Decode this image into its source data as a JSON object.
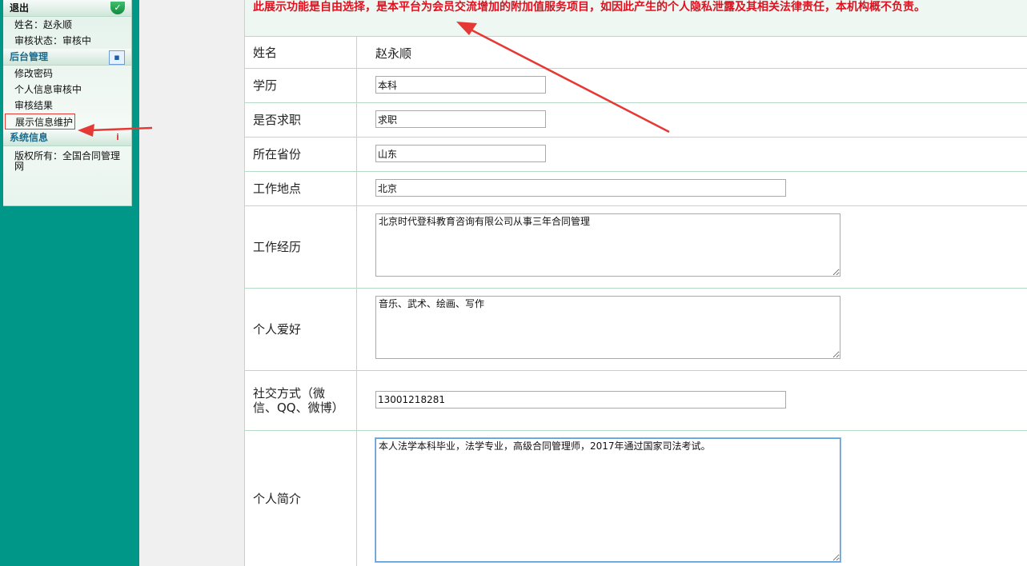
{
  "sidebar": {
    "section_logout": "退出",
    "user_name": "姓名：赵永顺",
    "audit_status": "审核状态：审核中",
    "section_admin": "后台管理",
    "items": [
      "修改密码",
      "个人信息审核中",
      "审核结果",
      "展示信息维护"
    ],
    "section_system": "系统信息",
    "copyright": "版权所有：全国合同管理网"
  },
  "notice": "此展示功能是自由选择，是本平台为会员交流增加的附加值服务项目，如因此产生的个人隐私泄露及其相关法律责任，本机构概不负责。",
  "form": {
    "name_label": "姓名",
    "name_value": "赵永顺",
    "education_label": "学历",
    "education_value": "本科",
    "job_label": "是否求职",
    "job_value": "求职",
    "province_label": "所在省份",
    "province_value": "山东",
    "location_label": "工作地点",
    "location_value": "北京",
    "experience_label": "工作经历",
    "experience_value": "北京时代登科教育咨询有限公司从事三年合同管理",
    "hobby_label": "个人爱好",
    "hobby_value": "音乐、武术、绘画、写作",
    "contact_label": "社交方式（微信、QQ、微博）",
    "contact_value": "13001218281",
    "intro_label": "个人简介",
    "intro_value": "本人法学本科毕业，法学专业，高级合同管理师，2017年通过国家司法考试。"
  },
  "colors": {
    "sidebar_bg": "#009688",
    "notice_text": "#e0101f",
    "annotation": "#e53935",
    "border": "#b7d9c8"
  },
  "icons": [
    "shield-icon",
    "person-card-icon",
    "info-icon"
  ]
}
